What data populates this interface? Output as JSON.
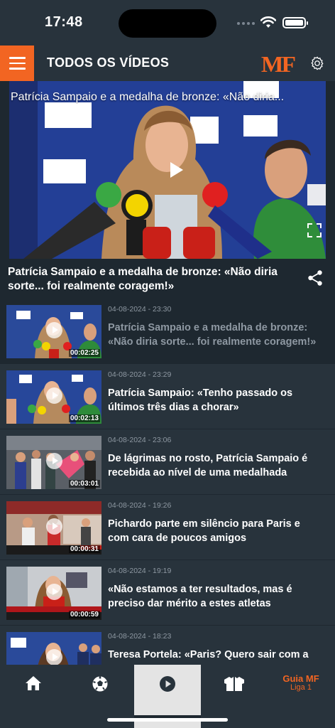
{
  "status_bar": {
    "time": "17:48"
  },
  "header": {
    "title": "TODOS OS VÍDEOS",
    "logo": "MF",
    "accent_color": "#f26522"
  },
  "hero": {
    "overlay_title": "Patrícia Sampaio e a medalha de bronze: «Não diria...",
    "title": "Patrícia Sampaio e a medalha de bronze: «Não diria sorte... foi realmente coragem!»"
  },
  "videos": [
    {
      "date": "04-08-2024 - 23:30",
      "title": "Patrícia Sampaio e a medalha de bronze: «Não diria sorte... foi realmente coragem!»",
      "duration": "00:02:25"
    },
    {
      "date": "04-08-2024 - 23:29",
      "title": "Patrícia Sampaio: «Tenho passado os últimos três dias a chorar»",
      "duration": "00:02:13"
    },
    {
      "date": "04-08-2024 - 23:06",
      "title": "De lágrimas no rosto, Patrícia Sampaio é recebida ao nível de uma medalhada",
      "duration": "00:03:01"
    },
    {
      "date": "04-08-2024 - 19:26",
      "title": "Pichardo parte em silêncio para Paris e com cara de poucos amigos",
      "duration": "00:00:31"
    },
    {
      "date": "04-08-2024 - 19:19",
      "title": "«Não estamos a ter resultados, mas é preciso dar mérito a estes atletas",
      "duration": "00:00:59"
    },
    {
      "date": "04-08-2024 - 18:23",
      "title": "Teresa Portela: «Paris? Quero sair com a",
      "duration": ""
    }
  ],
  "bottom_nav": {
    "items": [
      {
        "icon": "home-icon"
      },
      {
        "icon": "football-icon"
      },
      {
        "icon": "play-icon"
      },
      {
        "icon": "jersey-icon"
      }
    ],
    "guia_label": "Guia MF",
    "guia_sub": "Liga 1"
  }
}
